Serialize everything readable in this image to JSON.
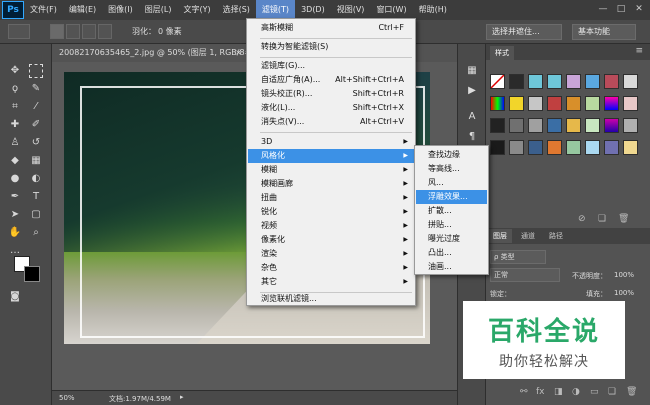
{
  "menubar": {
    "logo": "Ps",
    "items": [
      "文件(F)",
      "编辑(E)",
      "图像(I)",
      "图层(L)",
      "文字(Y)",
      "选择(S)",
      "滤镜(T)",
      "3D(D)",
      "视图(V)",
      "窗口(W)",
      "帮助(H)"
    ],
    "window_controls": [
      "—",
      "□",
      "✕"
    ]
  },
  "options_bar": {
    "feather_label": "羽化：",
    "feather_value": "0 像素",
    "select_and_mask": "选择并遮住...",
    "workspace": "基本功能"
  },
  "document": {
    "tab_title": "20082170635465_2.jpg @ 50% (图层 1, RGB/8#) *",
    "tab_close": "×",
    "zoom": "50%",
    "doc_info": "文档:1.97M/4.59M"
  },
  "filter_menu": {
    "items": [
      {
        "label": "高斯模糊",
        "shortcut": "Ctrl+F"
      },
      {
        "label": "转换为智能滤镜(S)",
        "shortcut": ""
      },
      {
        "label": "滤镜库(G)...",
        "shortcut": ""
      },
      {
        "label": "自适应广角(A)...",
        "shortcut": "Alt+Shift+Ctrl+A"
      },
      {
        "label": "镜头校正(R)...",
        "shortcut": "Shift+Ctrl+R"
      },
      {
        "label": "液化(L)...",
        "shortcut": "Shift+Ctrl+X"
      },
      {
        "label": "消失点(V)...",
        "shortcut": "Alt+Ctrl+V"
      },
      {
        "label": "3D",
        "shortcut": ""
      },
      {
        "label": "风格化",
        "shortcut": ""
      },
      {
        "label": "模糊",
        "shortcut": ""
      },
      {
        "label": "模糊画廊",
        "shortcut": ""
      },
      {
        "label": "扭曲",
        "shortcut": ""
      },
      {
        "label": "锐化",
        "shortcut": ""
      },
      {
        "label": "视频",
        "shortcut": ""
      },
      {
        "label": "像素化",
        "shortcut": ""
      },
      {
        "label": "渲染",
        "shortcut": ""
      },
      {
        "label": "杂色",
        "shortcut": ""
      },
      {
        "label": "其它",
        "shortcut": ""
      },
      {
        "label": "浏览联机滤镜...",
        "shortcut": ""
      }
    ]
  },
  "stylize_submenu": {
    "items": [
      "查找边缘",
      "等高线...",
      "风...",
      "浮雕效果...",
      "扩散...",
      "拼贴...",
      "曝光过度",
      "凸出...",
      "油画..."
    ]
  },
  "styles_panel": {
    "tab": "样式"
  },
  "layers_panel": {
    "tabs": [
      "图层",
      "通道",
      "路径"
    ],
    "filter_kind": "ρ 类型",
    "blend_mode": "正常",
    "opacity_label": "不透明度：",
    "opacity_value": "100%",
    "lock_label": "锁定：",
    "fill_label": "填充：",
    "fill_value": "100%"
  },
  "watermark": {
    "title": "百科全说",
    "subtitle": "助你轻松解决"
  }
}
